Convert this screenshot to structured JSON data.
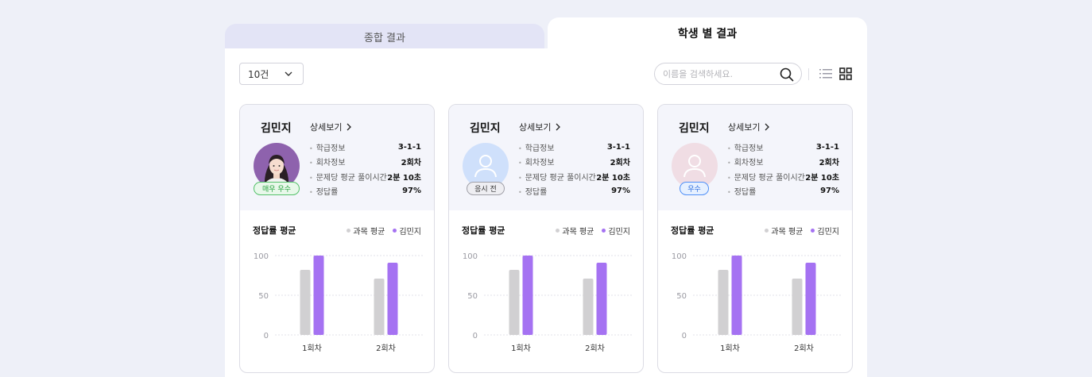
{
  "tabs": [
    {
      "label": "종합 결과",
      "active": false
    },
    {
      "label": "학생 별 결과",
      "active": true
    }
  ],
  "toolbar": {
    "page_size": "10건",
    "search_placeholder": "이름을 검색하세요.",
    "search_value": "",
    "icons": {
      "dropdown": "chevron-down-icon",
      "search": "search-icon",
      "list_view": "list-view-icon",
      "grid_view": "grid-view-icon"
    }
  },
  "cards": [
    {
      "name": "김민지",
      "detail_link": "상세보기",
      "badge": "매우 우수",
      "avatar": "photo",
      "info": [
        {
          "label": "학급정보",
          "value": "3-1-1"
        },
        {
          "label": "회차정보",
          "value": "2회차"
        },
        {
          "label": "문제당 평균 풀이시간",
          "value": "2분 10초"
        },
        {
          "label": "정답률",
          "value": "97%"
        }
      ],
      "chart_title": "정답률 평균",
      "legend": [
        "과목 평균",
        "김민지"
      ]
    },
    {
      "name": "김민지",
      "detail_link": "상세보기",
      "badge": "응시 전",
      "avatar": "placeholder-blue",
      "info": [
        {
          "label": "학급정보",
          "value": "3-1-1"
        },
        {
          "label": "회차정보",
          "value": "2회차"
        },
        {
          "label": "문제당 평균 풀이시간",
          "value": "2분 10초"
        },
        {
          "label": "정답률",
          "value": "97%"
        }
      ],
      "chart_title": "정답률 평균",
      "legend": [
        "과목 평균",
        "김민지"
      ]
    },
    {
      "name": "김민지",
      "detail_link": "상세보기",
      "badge": "우수",
      "avatar": "placeholder-pink",
      "info": [
        {
          "label": "학급정보",
          "value": "3-1-1"
        },
        {
          "label": "회차정보",
          "value": "2회차"
        },
        {
          "label": "문제당 평균 풀이시간",
          "value": "2분 10초"
        },
        {
          "label": "정답률",
          "value": "97%"
        }
      ],
      "chart_title": "정답률 평균",
      "legend": [
        "과목 평균",
        "김민지"
      ]
    }
  ],
  "colors": {
    "series_avg": "#d1d0d2",
    "series_student": "#a572f2",
    "badge_excellent": "#27a33f",
    "badge_before": "#555555",
    "badge_good": "#2f6fe0",
    "avatar_blue": "#cfe0fb",
    "avatar_pink": "#f0dde4"
  },
  "chart_data": [
    {
      "type": "bar",
      "title": "정답률 평균",
      "categories": [
        "1회차",
        "2회차"
      ],
      "series": [
        {
          "name": "과목 평균",
          "values": [
            82,
            71
          ]
        },
        {
          "name": "김민지",
          "values": [
            100,
            91
          ]
        }
      ],
      "ylim": [
        0,
        100
      ],
      "yticks": [
        0,
        50,
        100
      ],
      "grid": true,
      "legend_position": "top-right"
    },
    {
      "type": "bar",
      "title": "정답률 평균",
      "categories": [
        "1회차",
        "2회차"
      ],
      "series": [
        {
          "name": "과목 평균",
          "values": [
            82,
            71
          ]
        },
        {
          "name": "김민지",
          "values": [
            100,
            91
          ]
        }
      ],
      "ylim": [
        0,
        100
      ],
      "yticks": [
        0,
        50,
        100
      ],
      "grid": true,
      "legend_position": "top-right"
    },
    {
      "type": "bar",
      "title": "정답률 평균",
      "categories": [
        "1회차",
        "2회차"
      ],
      "series": [
        {
          "name": "과목 평균",
          "values": [
            82,
            71
          ]
        },
        {
          "name": "김민지",
          "values": [
            100,
            91
          ]
        }
      ],
      "ylim": [
        0,
        100
      ],
      "yticks": [
        0,
        50,
        100
      ],
      "grid": true,
      "legend_position": "top-right"
    }
  ]
}
